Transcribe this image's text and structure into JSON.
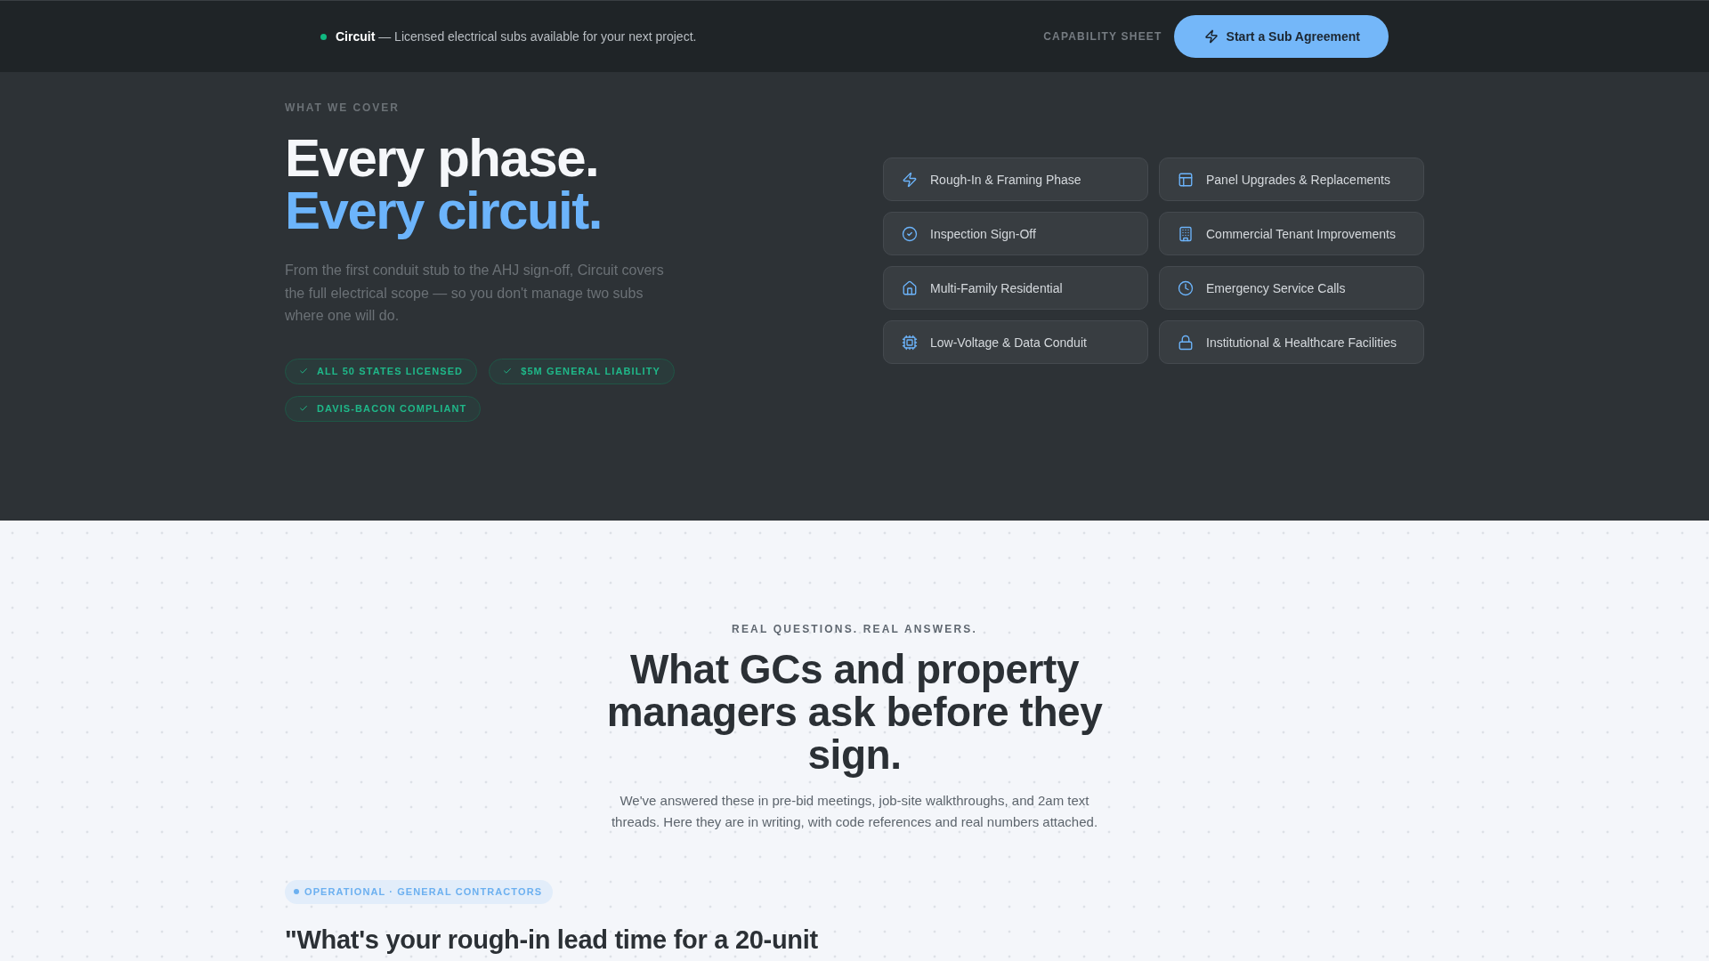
{
  "announcement_bar": {
    "text": "**Circuit** — Licensed electrical subs available for your next project.",
    "link": "CAPABILITY SHEET",
    "button": "Start a Sub Agreement"
  },
  "coverage": {
    "eyebrow": "WHAT WE COVER",
    "title": "Every phase.",
    "title_accent": "Every circuit.",
    "description": "From the first conduit stub to the AHJ sign-off, Circuit covers the full electrical scope — so you don't manage two subs where one will do.",
    "credentials": [
      "ALL 50 STATES LICENSED",
      "$5M GENERAL LIABILITY",
      "DAVIS-BACON COMPLIANT"
    ],
    "services": [
      "Rough-In & Framing Phase",
      "Panel Upgrades & Replacements",
      "Inspection Sign-Off",
      "Commercial Tenant Improvements",
      "Multi-Family Residential",
      "Emergency Service Calls",
      "Low-Voltage & Data Conduit",
      "Institutional & Healthcare Facilities"
    ]
  },
  "faq": {
    "eyebrow": "REAL QUESTIONS. REAL ANSWERS.",
    "title": "What GCs and property managers ask before they sign.",
    "intro": "We've answered these in pre-bid meetings, job-site walkthroughs, and 2am text threads. Here they are in writing, with code references and real numbers attached.",
    "category": "OPERATIONAL · GENERAL CONTRACTORS",
    "question": "\"What's your rough-in lead time for a 20-unit"
  }
}
